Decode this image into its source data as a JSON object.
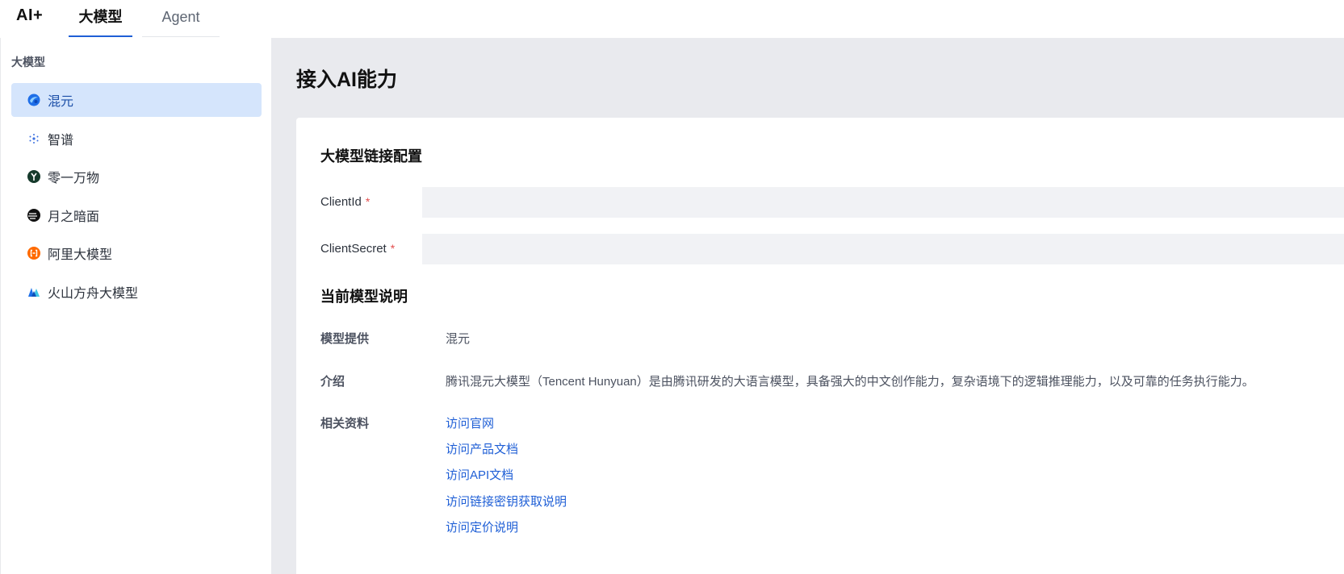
{
  "header": {
    "brand": "AI+",
    "tabs": [
      {
        "label": "大模型",
        "active": true
      },
      {
        "label": "Agent",
        "active": false
      }
    ]
  },
  "sidebar": {
    "title": "大模型",
    "items": [
      {
        "label": "混元",
        "icon": "hunyuan-icon",
        "active": true
      },
      {
        "label": "智谱",
        "icon": "zhipu-icon",
        "active": false
      },
      {
        "label": "零一万物",
        "icon": "lingyiwanwu-icon",
        "active": false
      },
      {
        "label": "月之暗面",
        "icon": "moonshot-icon",
        "active": false
      },
      {
        "label": "阿里大模型",
        "icon": "aliyun-icon",
        "active": false
      },
      {
        "label": "火山方舟大模型",
        "icon": "volcengine-icon",
        "active": false
      }
    ]
  },
  "main": {
    "title": "接入AI能力",
    "config_section": {
      "title": "大模型链接配置",
      "fields": [
        {
          "label": "ClientId",
          "required_mark": "*",
          "value": "",
          "placeholder": ""
        },
        {
          "label": "ClientSecret",
          "required_mark": "*",
          "value": "",
          "placeholder": ""
        }
      ]
    },
    "info_section": {
      "title": "当前模型说明",
      "provider_label": "模型提供",
      "provider_value": "混元",
      "intro_label": "介绍",
      "intro_value": "腾讯混元大模型（Tencent Hunyuan）是由腾讯研发的大语言模型，具备强大的中文创作能力，复杂语境下的逻辑推理能力，以及可靠的任务执行能力。",
      "resources_label": "相关资料",
      "links": [
        "访问官网",
        "访问产品文档",
        "访问API文档",
        "访问链接密钥获取说明",
        "访问定价说明"
      ]
    }
  },
  "colors": {
    "accent": "#1f5fd6",
    "active_bg": "#d5e5fc",
    "required": "#e34d4d",
    "page_bg": "#e9eaee"
  }
}
